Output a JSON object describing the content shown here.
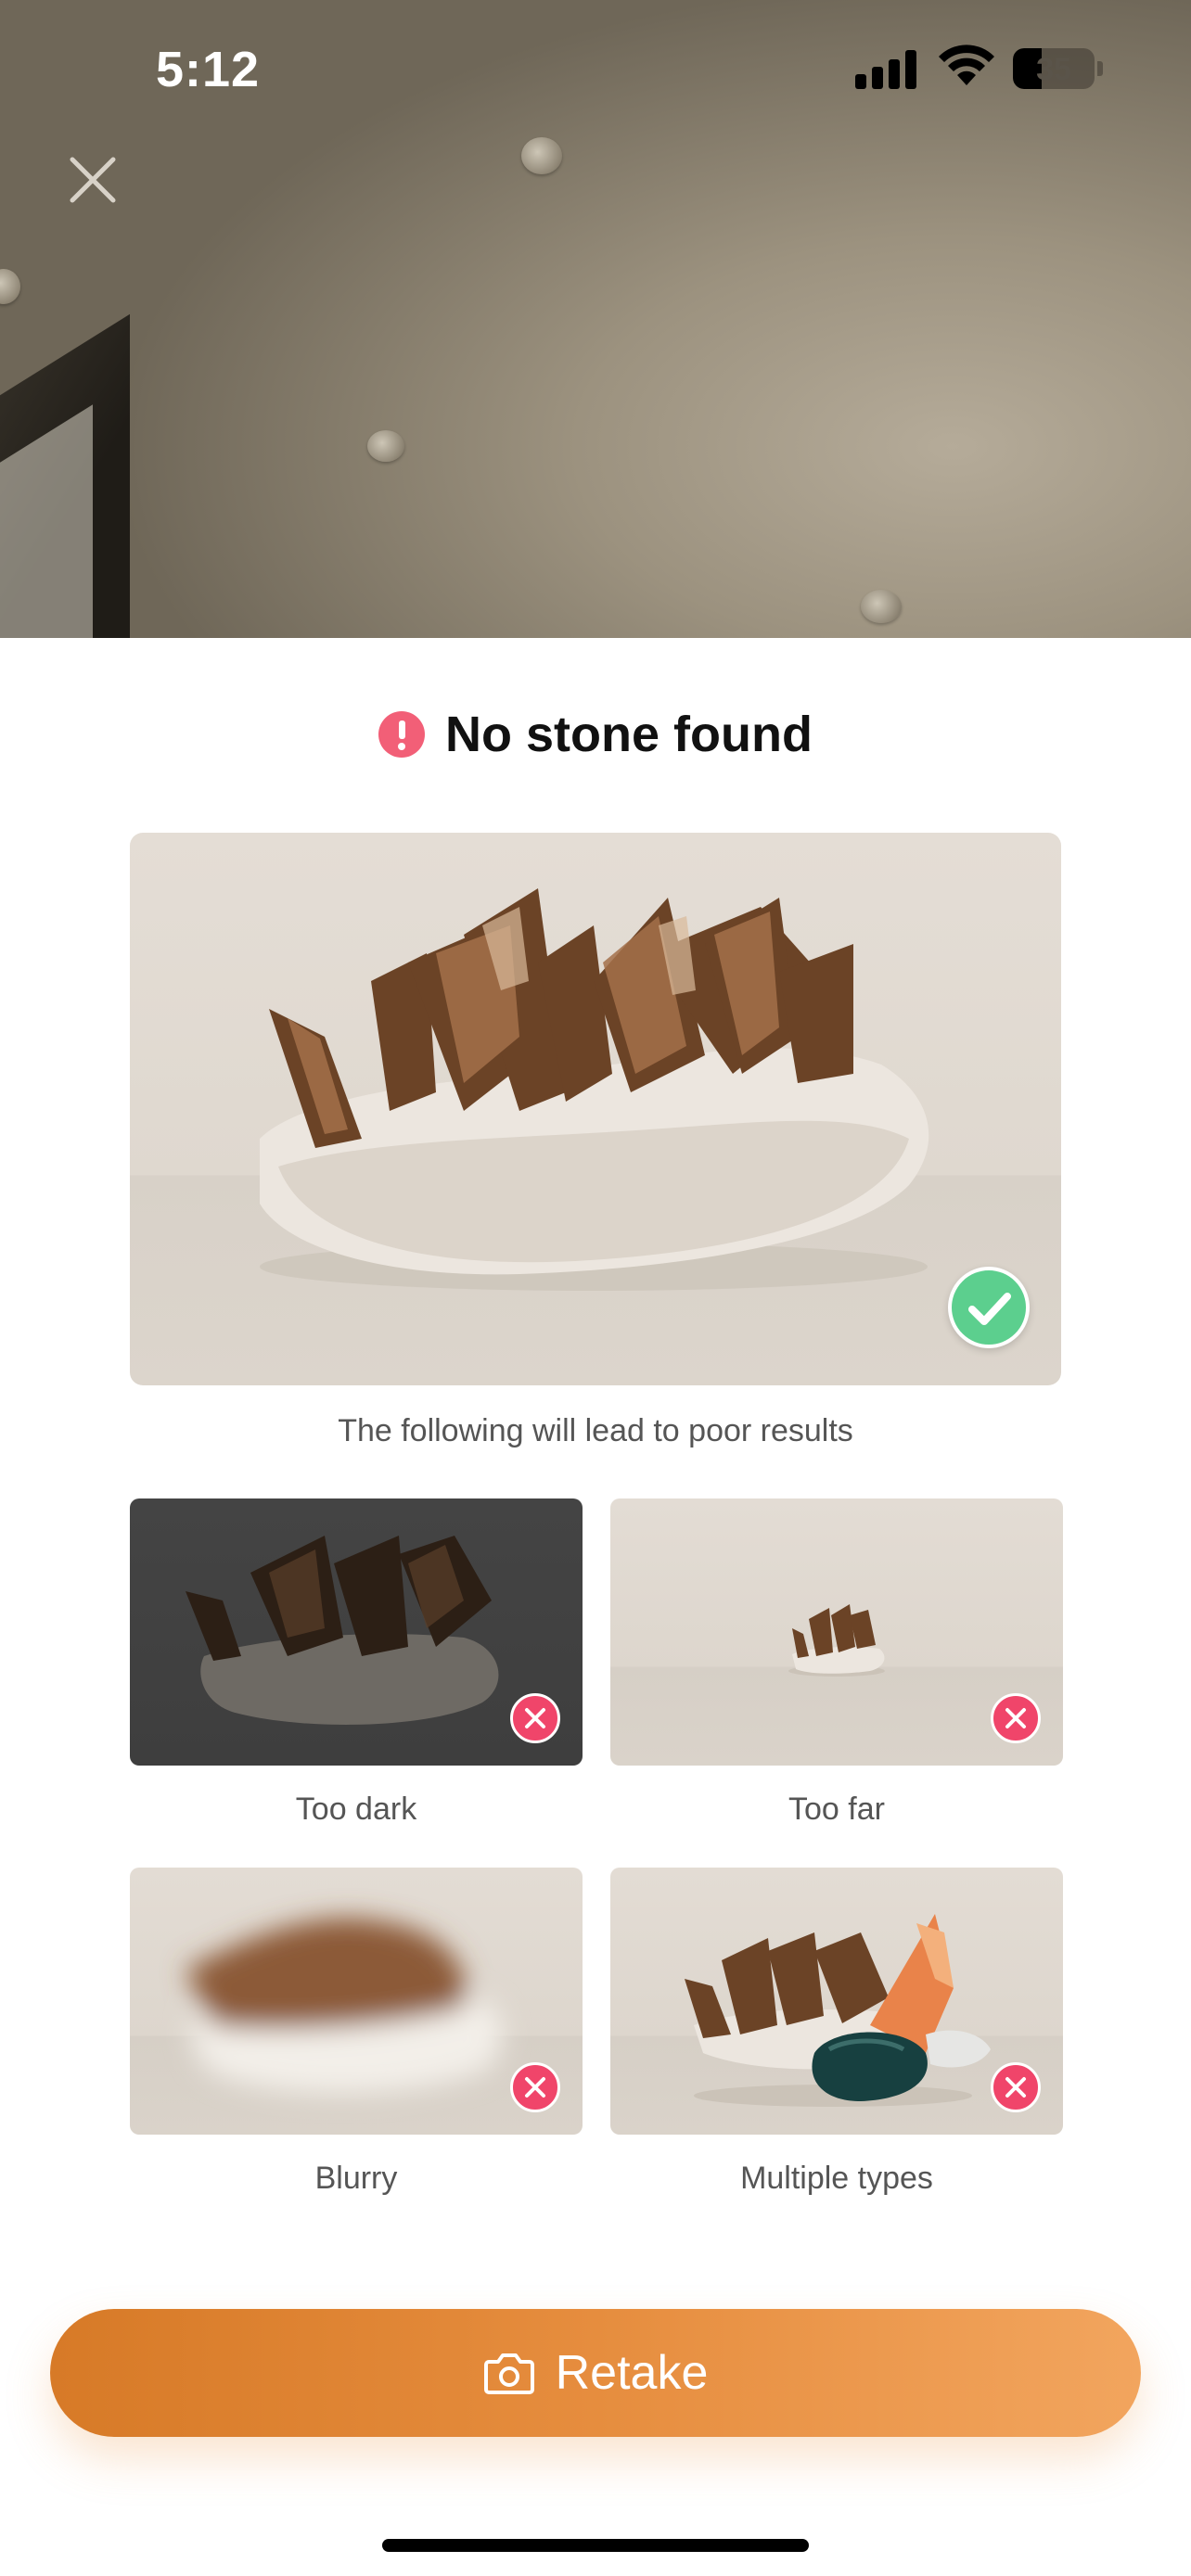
{
  "status_bar": {
    "time": "5:12",
    "battery_level": "35"
  },
  "camera": {
    "close_icon": "close-icon"
  },
  "result": {
    "title": "No stone found",
    "alert_icon": "exclamation-circle-icon",
    "alert_color": "#f25f77",
    "good_example_badge": "check-icon",
    "badge_good_color": "#5ccf8e",
    "badge_bad_color": "#f0456a",
    "caption": "The following will lead to poor results",
    "examples": [
      {
        "label": "Too dark",
        "badge": "x-icon"
      },
      {
        "label": "Too far",
        "badge": "x-icon"
      },
      {
        "label": "Blurry",
        "badge": "x-icon"
      },
      {
        "label": "Multiple types",
        "badge": "x-icon"
      }
    ]
  },
  "retake_button": {
    "label": "Retake",
    "icon": "camera-icon",
    "gradient_start": "#d77a27",
    "gradient_end": "#f2a55e"
  }
}
